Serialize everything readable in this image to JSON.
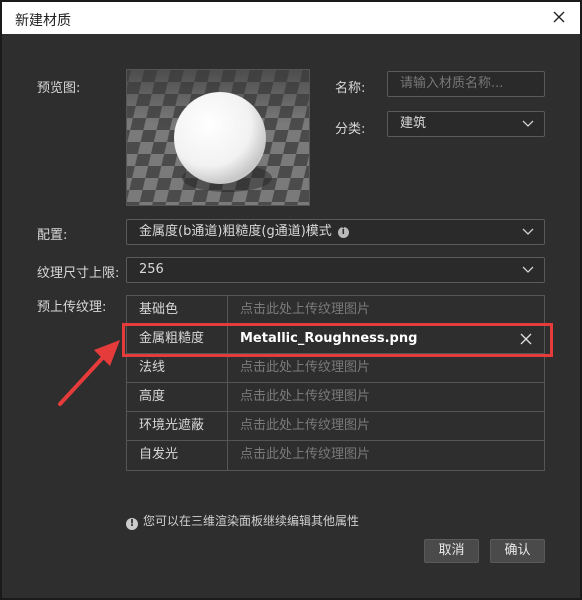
{
  "window": {
    "title": "新建材质"
  },
  "form": {
    "preview_label": "预览图:",
    "name_label": "名称:",
    "name_placeholder": "请输入材质名称...",
    "category_label": "分类:",
    "category_value": "建筑",
    "config_label": "配置:",
    "config_value": "金属度(b通道)粗糙度(g通道)模式",
    "texture_limit_label": "纹理尺寸上限:",
    "texture_limit_value": "256",
    "preupload_label": "预上传纹理:"
  },
  "textures": [
    {
      "name": "基础色",
      "value": "点击此处上传纹理图片",
      "uploaded": false
    },
    {
      "name": "金属粗糙度",
      "value": "Metallic_Roughness.png",
      "uploaded": true
    },
    {
      "name": "法线",
      "value": "点击此处上传纹理图片",
      "uploaded": false
    },
    {
      "name": "高度",
      "value": "点击此处上传纹理图片",
      "uploaded": false
    },
    {
      "name": "环境光遮蔽",
      "value": "点击此处上传纹理图片",
      "uploaded": false
    },
    {
      "name": "自发光",
      "value": "点击此处上传纹理图片",
      "uploaded": false
    }
  ],
  "note": "您可以在三维渲染面板继续编辑其他属性",
  "buttons": {
    "cancel": "取消",
    "confirm": "确认"
  },
  "colors": {
    "background": "#2e2e2e",
    "highlight": "#e53b3b"
  },
  "icons": {
    "close": "close-icon",
    "chevron": "chevron-down-icon",
    "info": "info-icon",
    "remove": "remove-icon"
  }
}
